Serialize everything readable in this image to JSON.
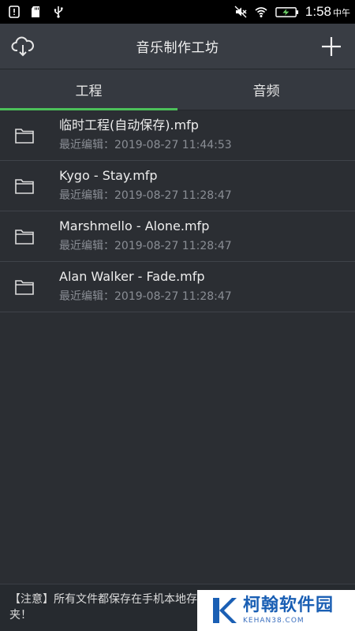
{
  "status_bar": {
    "time": "1:58",
    "ampm": "中午",
    "icons": [
      "alert-icon",
      "sd-card-icon",
      "usb-icon",
      "mute-icon",
      "wifi-icon",
      "battery-charging-icon"
    ]
  },
  "toolbar": {
    "title": "音乐制作工坊",
    "left_icon": "cloud-download-icon",
    "right_icon": "add-icon"
  },
  "tabs": [
    {
      "label": "工程",
      "active": true
    },
    {
      "label": "音频",
      "active": false
    }
  ],
  "files": [
    {
      "name": "临时工程(自动保存).mfp",
      "meta": "最近编辑：2019-08-27 11:44:53"
    },
    {
      "name": "Kygo - Stay.mfp",
      "meta": "最近编辑：2019-08-27 11:28:47"
    },
    {
      "name": "Marshmello - Alone.mfp",
      "meta": "最近编辑：2019-08-27 11:28:47"
    },
    {
      "name": "Alan Walker - Fade.mfp",
      "meta": "最近编辑：2019-08-27 11:28:47"
    }
  ],
  "notice": {
    "text": "【注意】所有文件都保存在手机本地存储根目录的\"音乐制作工坊\"文件夹！"
  },
  "watermark": {
    "title": "柯翰软件园",
    "sub": "KEHAN38.COM"
  },
  "colors": {
    "accent": "#4cc05a",
    "background": "#2b2e33",
    "toolbar": "#393d44",
    "secondary_text": "#8a8e95"
  }
}
